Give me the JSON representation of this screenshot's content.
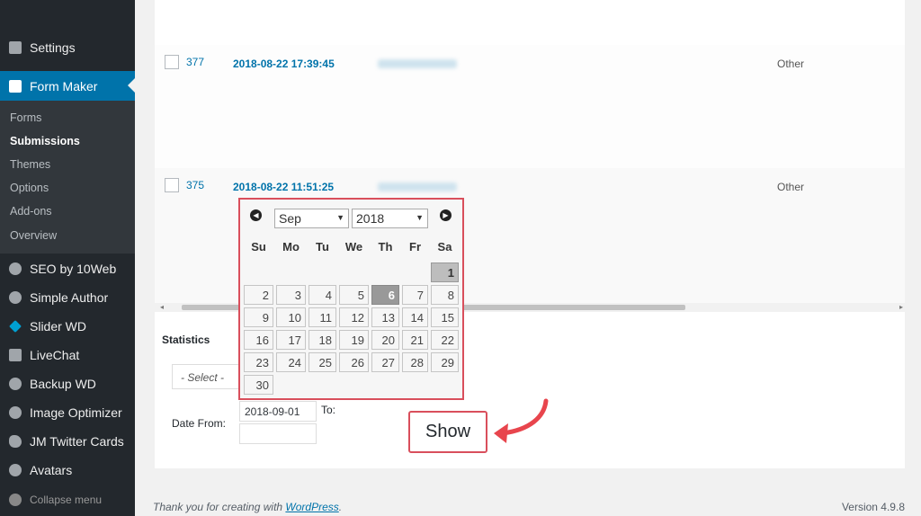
{
  "sidebar": {
    "settings": "Settings",
    "form_maker": "Form Maker",
    "submenu": [
      "Forms",
      "Submissions",
      "Themes",
      "Options",
      "Add-ons",
      "Overview"
    ],
    "plugins": [
      "SEO by 10Web",
      "Simple Author",
      "Slider WD",
      "LiveChat",
      "Backup WD",
      "Image Optimizer",
      "JM Twitter Cards",
      "Avatars",
      "Collapse menu"
    ]
  },
  "rows": [
    {
      "id": "377",
      "date": "2018-08-22 17:39:45",
      "type": "Other"
    },
    {
      "id": "375",
      "date": "2018-08-22 11:51:25",
      "type": "Other"
    }
  ],
  "stats": {
    "title": "Statistics",
    "select_placeholder": "- Select -",
    "date_from_label": "Date From:",
    "date_from_value": "2018-09-01",
    "to_label": "To:",
    "to_value": "",
    "show_button": "Show"
  },
  "datepicker": {
    "month": "Sep",
    "year": "2018",
    "weekdays": [
      "Su",
      "Mo",
      "Tu",
      "We",
      "Th",
      "Fr",
      "Sa"
    ],
    "days": [
      "1",
      "2",
      "3",
      "4",
      "5",
      "6",
      "7",
      "8",
      "9",
      "10",
      "11",
      "12",
      "13",
      "14",
      "15",
      "16",
      "17",
      "18",
      "19",
      "20",
      "21",
      "22",
      "23",
      "24",
      "25",
      "26",
      "27",
      "28",
      "29",
      "30"
    ]
  },
  "footer": {
    "thanks_prefix": "Thank you for creating with ",
    "thanks_link": "WordPress",
    "thanks_suffix": ".",
    "version": "Version 4.9.8"
  },
  "colors": {
    "accent": "#0073aa",
    "highlight": "#d94f5c"
  }
}
